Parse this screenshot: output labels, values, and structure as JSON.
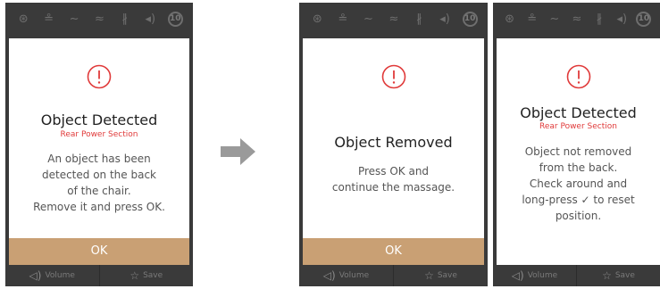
{
  "status_icons": [
    "massage-icon",
    "air-icon",
    "stretch-icon",
    "heat-icon",
    "bluetooth-icon",
    "volume-icon",
    "timer-badge-icon"
  ],
  "timer_badge": "10",
  "screen1": {
    "title": "Object Detected",
    "subtitle": "Rear Power Section",
    "message": [
      "An object has been",
      "detected on the back",
      "of the chair.",
      "Remove it and press OK."
    ],
    "ok_label": "OK"
  },
  "screen2": {
    "title": "Object Removed",
    "message": [
      "Press OK and",
      "continue the massage."
    ],
    "ok_label": "OK"
  },
  "screen3": {
    "title": "Object Detected",
    "subtitle": "Rear Power Section",
    "message": [
      "Object not removed",
      "from the back.",
      "Check around and",
      "long-press ✓ to reset",
      "position."
    ]
  },
  "bottom": {
    "volume_label": "Volume",
    "save_label": "Save"
  },
  "colors": {
    "panel": "#3a3a3a",
    "ok_bar": "#c9a074",
    "alert_red": "#e03a3a",
    "arrow": "#9a9a9a"
  }
}
